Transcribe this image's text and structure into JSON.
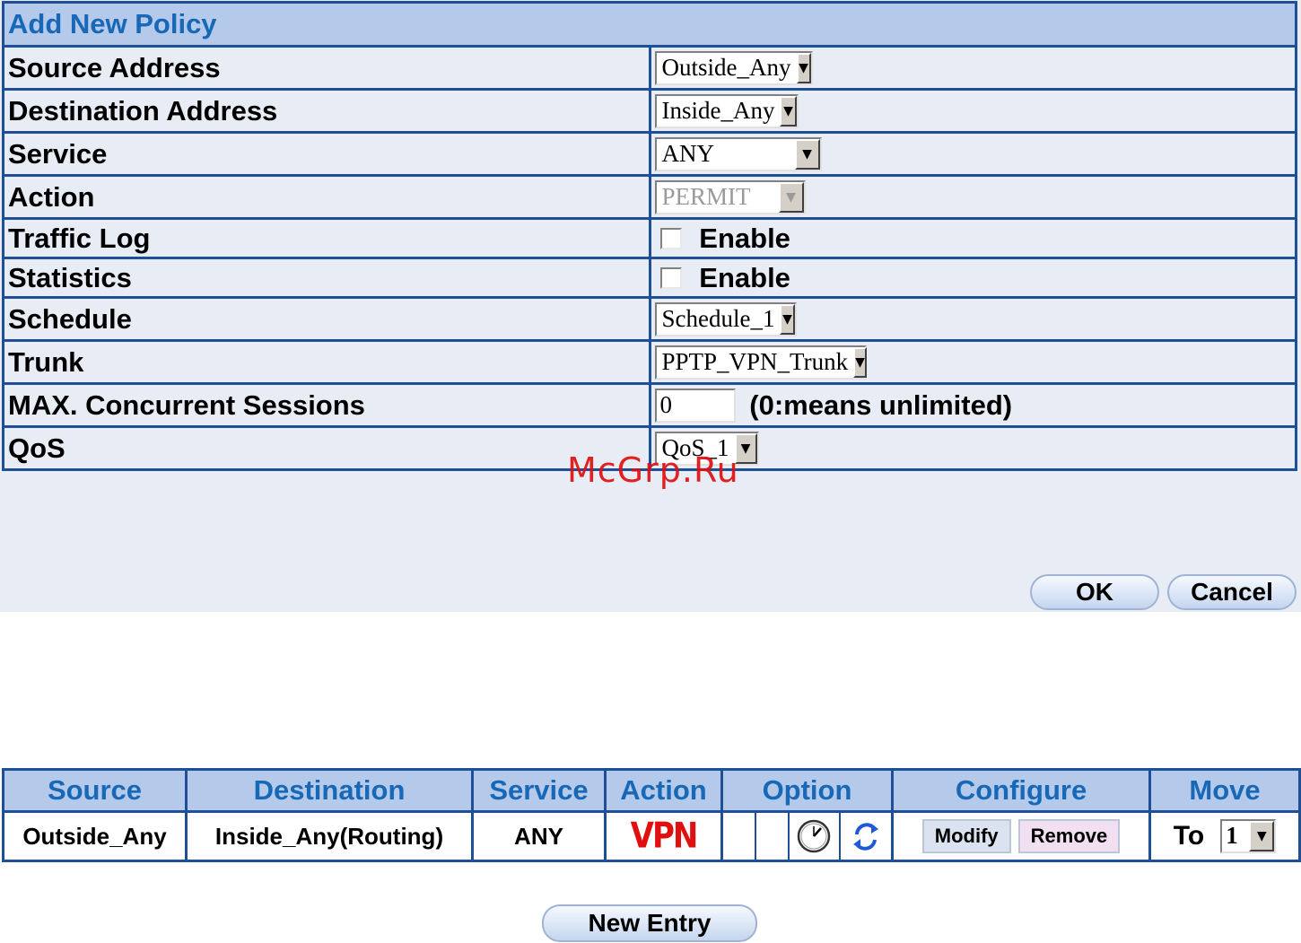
{
  "form": {
    "title": "Add New Policy",
    "rows": {
      "source_address": {
        "label": "Source Address",
        "value": "Outside_Any"
      },
      "destination_address": {
        "label": "Destination Address",
        "value": "Inside_Any"
      },
      "service": {
        "label": "Service",
        "value": "ANY"
      },
      "action": {
        "label": "Action",
        "value": "PERMIT"
      },
      "traffic_log": {
        "label": "Traffic Log",
        "checkbox_label": "Enable"
      },
      "statistics": {
        "label": "Statistics",
        "checkbox_label": "Enable"
      },
      "schedule": {
        "label": "Schedule",
        "value": "Schedule_1"
      },
      "trunk": {
        "label": "Trunk",
        "value": "PPTP_VPN_Trunk"
      },
      "max_sessions": {
        "label": "MAX. Concurrent Sessions",
        "value": "0",
        "hint": "(0:means unlimited)"
      },
      "qos": {
        "label": "QoS",
        "value": "QoS_1"
      }
    },
    "ok_label": "OK",
    "cancel_label": "Cancel"
  },
  "watermark": "McGrp.Ru",
  "list": {
    "headers": [
      "Source",
      "Destination",
      "Service",
      "Action",
      "Option",
      "Configure",
      "Move"
    ],
    "row": {
      "source": "Outside_Any",
      "destination": "Inside_Any(Routing)",
      "service": "ANY",
      "action_badge": "VPN",
      "modify_label": "Modify",
      "remove_label": "Remove",
      "move_to_label": "To",
      "move_value": "1"
    },
    "new_entry_label": "New Entry"
  },
  "icons": {
    "dropdown": "chevron-down-icon",
    "schedule": "clock-icon",
    "trunk": "vpn-trunk-icon"
  },
  "colors": {
    "header_bg": "#b5c9ea",
    "header_text": "#1868b8",
    "border": "#1f4f96",
    "vpn": "#e01010"
  }
}
